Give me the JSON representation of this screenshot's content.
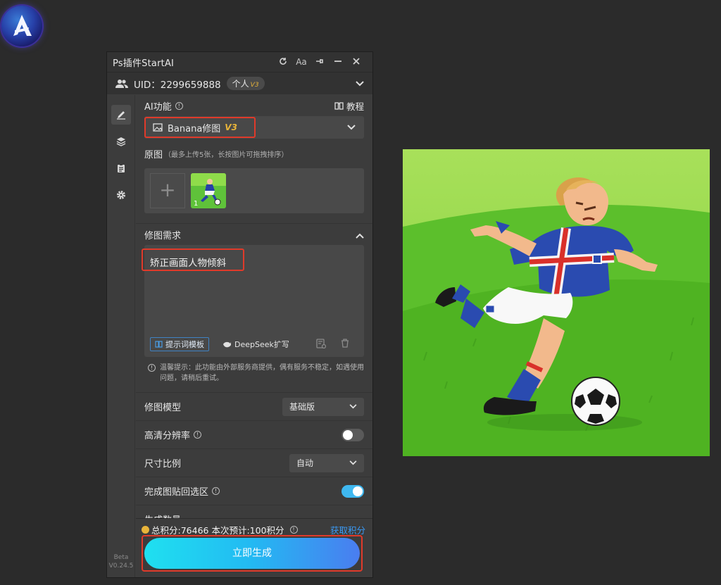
{
  "app": {
    "title": "Ps插件StartAI",
    "version_tag": "Beta",
    "version": "V0.24.5"
  },
  "titlebar_icons": [
    "refresh-icon",
    "font-size-icon",
    "pin-icon",
    "minimize-icon",
    "close-icon"
  ],
  "titlebar_labels": {
    "font": "Aa"
  },
  "user": {
    "uid_label": "UID：2299659888",
    "plan": "个人",
    "plan_version": "V3"
  },
  "ai": {
    "section_label": "AI功能",
    "tutorial_label": "教程",
    "feature": "Banana修图",
    "feature_version": "V3"
  },
  "source": {
    "label": "原图",
    "hint": "（最多上传5张，长按图片可拖拽排序）",
    "thumb_index": "1"
  },
  "request": {
    "label": "修图需求",
    "prompt": "矫正画面人物倾斜",
    "template_button": "提示词模板",
    "deepseek_button": "DeepSeek扩写",
    "tip": "温馨提示：此功能由外部服务商提供，偶有服务不稳定，如遇使用问题，请稍后重试。"
  },
  "options": {
    "model_label": "修图模型",
    "model_value": "基础版",
    "hd_label": "高清分辨率",
    "hd_on": false,
    "ratio_label": "尺寸比例",
    "ratio_value": "自动",
    "paste_label": "完成图贴回选区",
    "paste_on": true,
    "extra_label": "生成数量"
  },
  "footer": {
    "points_text": "总积分:76466  本次预计:100积分",
    "get_points": "获取积分",
    "generate_button": "立即生成"
  },
  "colors": {
    "accent_blue": "#3a9af5",
    "highlight_red": "#e03a2a",
    "toggle_on": "#3fb8f0",
    "gold": "#e8b43a"
  }
}
